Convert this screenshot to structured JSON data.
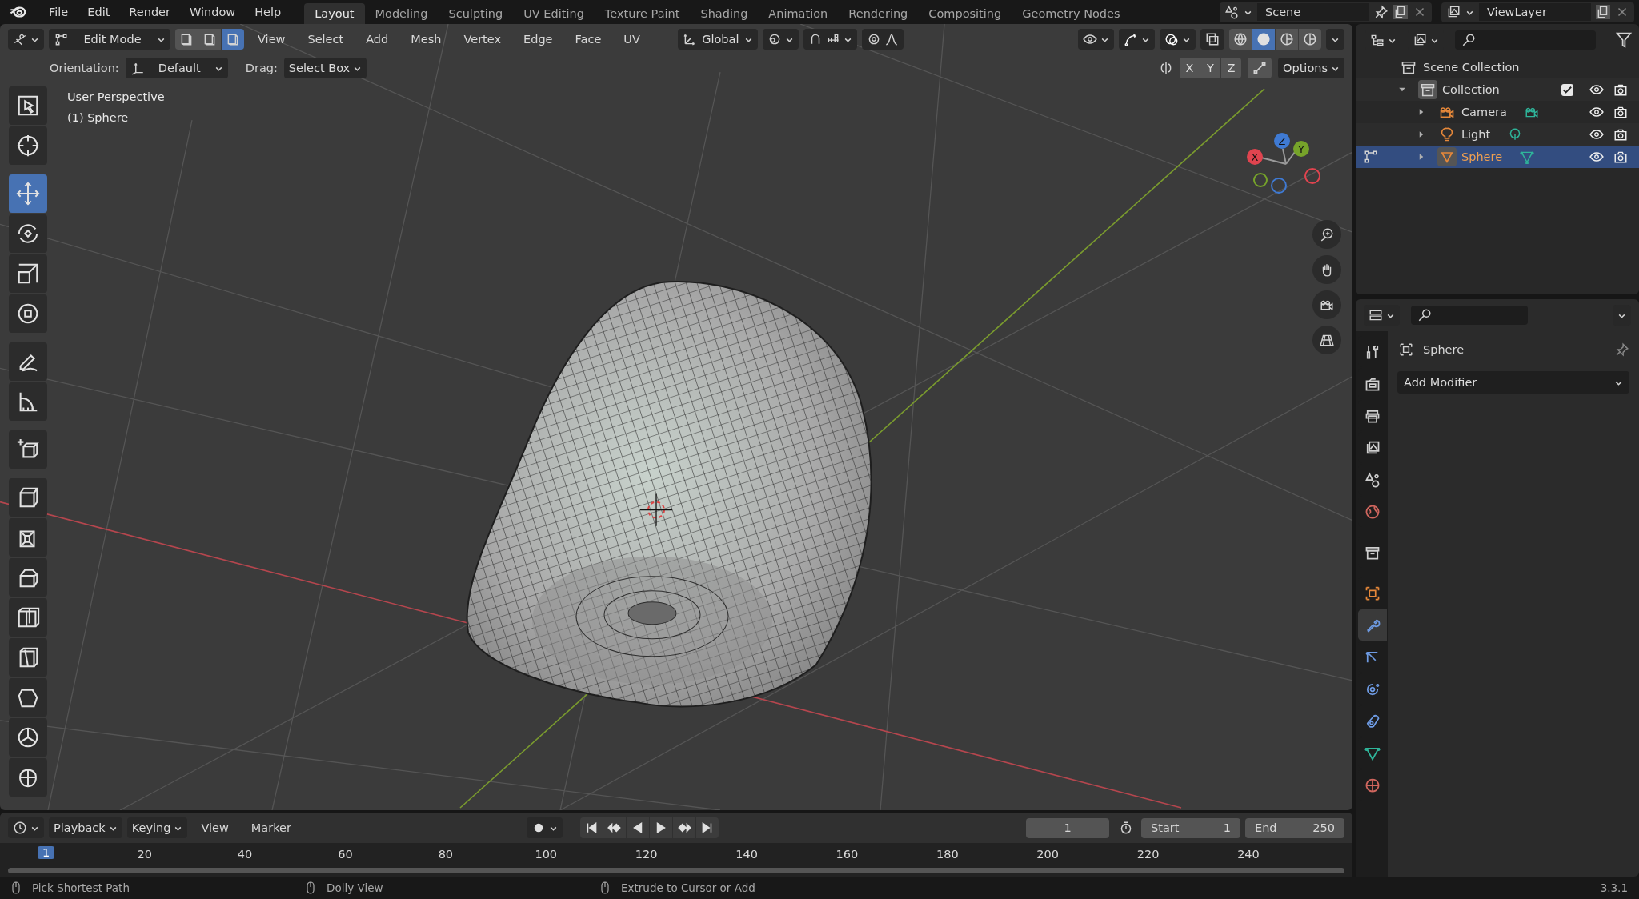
{
  "menu": [
    "File",
    "Edit",
    "Render",
    "Window",
    "Help"
  ],
  "workspaces": [
    {
      "label": "Layout",
      "selected": true
    },
    {
      "label": "Modeling",
      "selected": false
    },
    {
      "label": "Sculpting",
      "selected": false
    },
    {
      "label": "UV Editing",
      "selected": false
    },
    {
      "label": "Texture Paint",
      "selected": false
    },
    {
      "label": "Shading",
      "selected": false
    },
    {
      "label": "Animation",
      "selected": false
    },
    {
      "label": "Rendering",
      "selected": false
    },
    {
      "label": "Compositing",
      "selected": false
    },
    {
      "label": "Geometry Nodes",
      "selected": false
    }
  ],
  "scene": "Scene",
  "view_layer": "ViewLayer",
  "viewport": {
    "mode": "Edit Mode",
    "select_modes": [
      {
        "selected": false
      },
      {
        "selected": false
      },
      {
        "selected": true
      }
    ],
    "menus": [
      "View",
      "Select",
      "Add",
      "Mesh",
      "Vertex",
      "Edge",
      "Face",
      "UV"
    ],
    "orientation": "Global",
    "shading_modes": [
      {
        "selected": false
      },
      {
        "selected": true
      },
      {
        "selected": false
      },
      {
        "selected": false
      }
    ],
    "orientation_label": "Orientation:",
    "orientation_value": "Default",
    "drag_label": "Drag:",
    "drag_value": "Select Box",
    "mirror_axes": [
      "X",
      "Y",
      "Z"
    ],
    "options": "Options",
    "view_name": "User Perspective",
    "object_name": "(1) Sphere",
    "gizmo": [
      {
        "label": "X",
        "color": "#e0444f"
      },
      {
        "label": "Y",
        "color": "#76a32a"
      },
      {
        "label": "Z",
        "color": "#3f7ad3"
      }
    ]
  },
  "tools": [
    {
      "selected": false
    },
    {
      "selected": false
    },
    {
      "selected": true
    },
    {
      "selected": false
    },
    {
      "selected": false
    },
    {
      "selected": false
    },
    {
      "selected": false
    },
    {
      "selected": false
    },
    {
      "selected": false
    },
    {
      "selected": false
    },
    {
      "selected": false
    },
    {
      "selected": false
    },
    {
      "selected": false
    },
    {
      "selected": false
    },
    {
      "selected": false
    },
    {
      "selected": false
    },
    {
      "selected": false
    }
  ],
  "outliner": {
    "items": [
      {
        "label": "Scene Collection",
        "kind": "scene",
        "selected": false,
        "children": [
          {
            "label": "Collection",
            "kind": "collection",
            "expanded": true,
            "checked": true,
            "selected": false,
            "children": [
              {
                "label": "Camera",
                "kind": "camera",
                "expanded": false,
                "selected": false
              },
              {
                "label": "Light",
                "kind": "light",
                "expanded": false,
                "selected": false
              },
              {
                "label": "Sphere",
                "kind": "mesh",
                "expanded": false,
                "selected": true
              }
            ]
          }
        ]
      }
    ]
  },
  "properties": {
    "object": "Sphere",
    "add_modifier": "Add Modifier",
    "tabs": [
      {
        "selected": false
      },
      {
        "selected": false
      },
      {
        "selected": false
      },
      {
        "selected": false
      },
      {
        "selected": false
      },
      {
        "selected": false
      },
      {
        "selected": false
      },
      {
        "selected": false
      },
      {
        "selected": true
      },
      {
        "selected": false
      },
      {
        "selected": false
      },
      {
        "selected": false
      },
      {
        "selected": false
      },
      {
        "selected": false
      }
    ]
  },
  "timeline": {
    "menus": [
      {
        "label": "Playback",
        "dropdown": true
      },
      {
        "label": "Keying",
        "dropdown": true
      },
      {
        "label": "View",
        "dropdown": false
      },
      {
        "label": "Marker",
        "dropdown": false
      }
    ],
    "frame": "1",
    "start_label": "Start",
    "start": "1",
    "end_label": "End",
    "end": "250",
    "playhead": "1",
    "ticks": [
      "20",
      "40",
      "60",
      "80",
      "100",
      "120",
      "140",
      "160",
      "180",
      "200",
      "220",
      "240"
    ]
  },
  "status_bar": {
    "hints": [
      "Pick Shortest Path",
      "Dolly View",
      "Extrude to Cursor or Add"
    ],
    "version": "3.3.1"
  }
}
